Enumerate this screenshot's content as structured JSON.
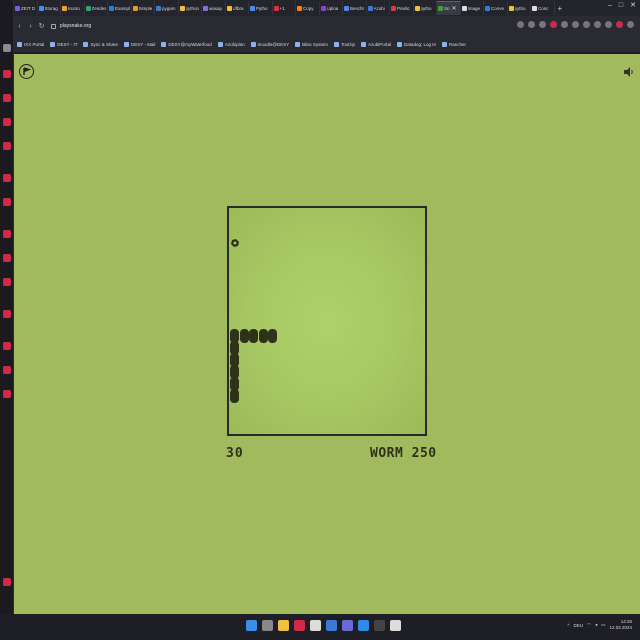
{
  "browser": {
    "tabs": [
      {
        "label": "ZEIT D",
        "color": "#7b5bd6"
      },
      {
        "label": "Storag",
        "color": "#4a8df0"
      },
      {
        "label": "Kursü",
        "color": "#f0a030"
      },
      {
        "label": "Zendes",
        "color": "#3aa070"
      },
      {
        "label": "Exampl",
        "color": "#2d7cd6"
      },
      {
        "label": "Simple",
        "color": "#e0a020"
      },
      {
        "label": "pygam",
        "color": "#3c7fc0"
      },
      {
        "label": "python",
        "color": "#f0c040"
      },
      {
        "label": "wasap",
        "color": "#8a6fd0"
      },
      {
        "label": "Ufbra",
        "color": "#f0c030"
      },
      {
        "label": "Pytho",
        "color": "#4a8df0"
      },
      {
        "label": "+1",
        "color": "#e03040"
      },
      {
        "label": "Copy",
        "color": "#f08020"
      },
      {
        "label": "Uploa",
        "color": "#8844cc"
      },
      {
        "label": "Bescht",
        "color": "#5588dd"
      },
      {
        "label": "Azubi",
        "color": "#3a7ad6"
      },
      {
        "label": "Predic",
        "color": "#d04040"
      },
      {
        "label": "pytho",
        "color": "#f0c040"
      },
      {
        "label": "Sn",
        "color": "#40a040",
        "active": true
      },
      {
        "label": "Image",
        "color": "#dddddd"
      },
      {
        "label": "Conve",
        "color": "#3a7ad6"
      },
      {
        "label": "pytho",
        "color": "#f0c040"
      },
      {
        "label": "Conc",
        "color": "#e0e0e0"
      }
    ],
    "new_tab": "+",
    "url": "playsnake.org",
    "bookmarks": [
      "IXX Portal",
      "DESY - IT",
      "Sync & Share",
      "DESY - Mail",
      "DESY@myWaterfood",
      "Azubiplan",
      "moodle@DESY",
      "Bliss System",
      "Toolzip",
      "AzubiPortal",
      "Datadog: Log In",
      "Rancher"
    ]
  },
  "game": {
    "score": "30",
    "best_label": "WORM 250",
    "snake_horizontal_count": 5,
    "snake_vertical_count": 5
  },
  "taskbar": {
    "lang": "DEU",
    "time": "14:26",
    "date": "12.02.2024"
  },
  "colors": {
    "page_bg": "#a2ba5e",
    "board_bg": "#aed169",
    "snake": "#2c3318",
    "accent": "#e0254a"
  }
}
